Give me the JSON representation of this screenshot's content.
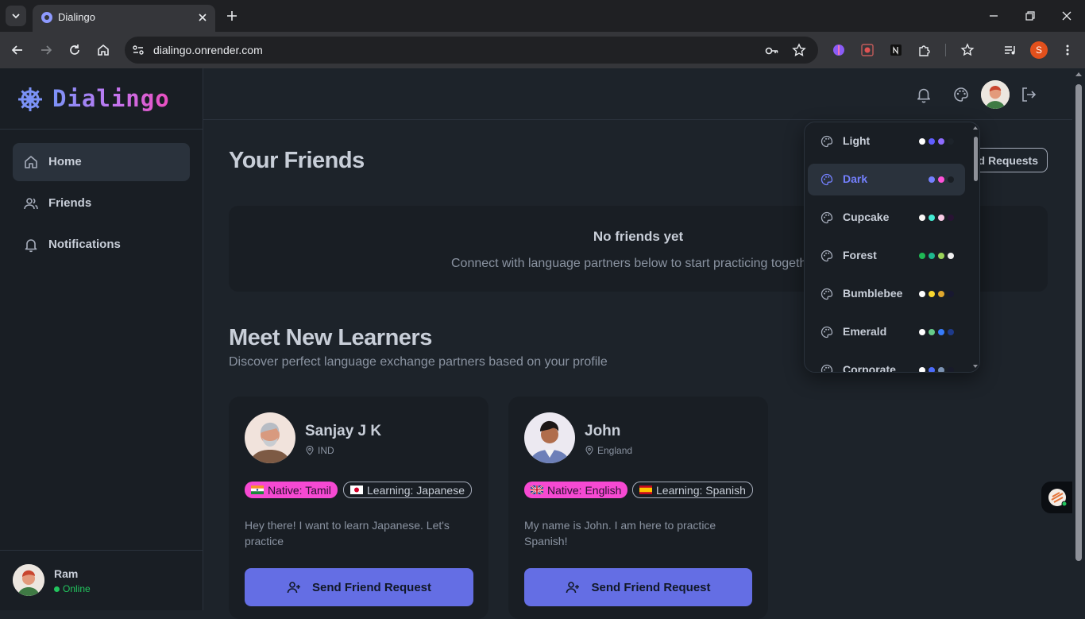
{
  "browser": {
    "tab_title": "Dialingo",
    "url": "dialingo.onrender.com",
    "profile_initial": "S"
  },
  "app": {
    "brand": "Dialingo",
    "nav": [
      {
        "label": "Home",
        "icon": "home-icon",
        "active": true
      },
      {
        "label": "Friends",
        "icon": "users-icon",
        "active": false
      },
      {
        "label": "Notifications",
        "icon": "bell-icon",
        "active": false
      }
    ],
    "user": {
      "name": "Ram",
      "status": "Online"
    },
    "friends": {
      "heading": "Your Friends",
      "requests_button": "Friend Requests",
      "empty_title": "No friends yet",
      "empty_subtitle": "Connect with language partners below to start practicing together!"
    },
    "meet": {
      "heading": "Meet New Learners",
      "subtitle": "Discover perfect language exchange partners based on your profile"
    },
    "learners": [
      {
        "name": "Sanjay J K",
        "location": "IND",
        "native": "Native: Tamil",
        "learning": "Learning: Japanese",
        "bio": "Hey there! I want to learn Japanese. Let's practice",
        "button": "Send Friend Request"
      },
      {
        "name": "John",
        "location": "England",
        "native": "Native: English",
        "learning": "Learning: Spanish",
        "bio": "My name is John. I am here to practice Spanish!",
        "button": "Send Friend Request"
      }
    ],
    "themes": [
      {
        "label": "Light",
        "colors": [
          "#ffffff",
          "#605dff",
          "#8e6cff",
          "#1d232a"
        ],
        "active": false
      },
      {
        "label": "Dark",
        "colors": [
          "#7480ff",
          "#ff52d9",
          "#191e24"
        ],
        "active": true
      },
      {
        "label": "Cupcake",
        "colors": [
          "#faf7f5",
          "#44ebd3",
          "#f9cbe5",
          "#291334"
        ],
        "active": false
      },
      {
        "label": "Forest",
        "colors": [
          "#1fb854",
          "#1eb88e",
          "#9bd35a",
          "#f0f0f0"
        ],
        "active": false
      },
      {
        "label": "Bumblebee",
        "colors": [
          "#ffffff",
          "#f9d72f",
          "#e0a82e",
          "#181830"
        ],
        "active": false
      },
      {
        "label": "Emerald",
        "colors": [
          "#ffffff",
          "#66cc8a",
          "#377cfb",
          "#1e3a8a"
        ],
        "active": false
      },
      {
        "label": "Corporate",
        "colors": [
          "#ffffff",
          "#4b6bfb",
          "#7b92b2",
          "#181a2a"
        ],
        "active": false
      }
    ]
  },
  "colors": {
    "background": "#1d232a",
    "sidebar": "#191e24",
    "primary": "#646ee4",
    "native_badge": "#f649d2",
    "online": "#22c55e"
  }
}
